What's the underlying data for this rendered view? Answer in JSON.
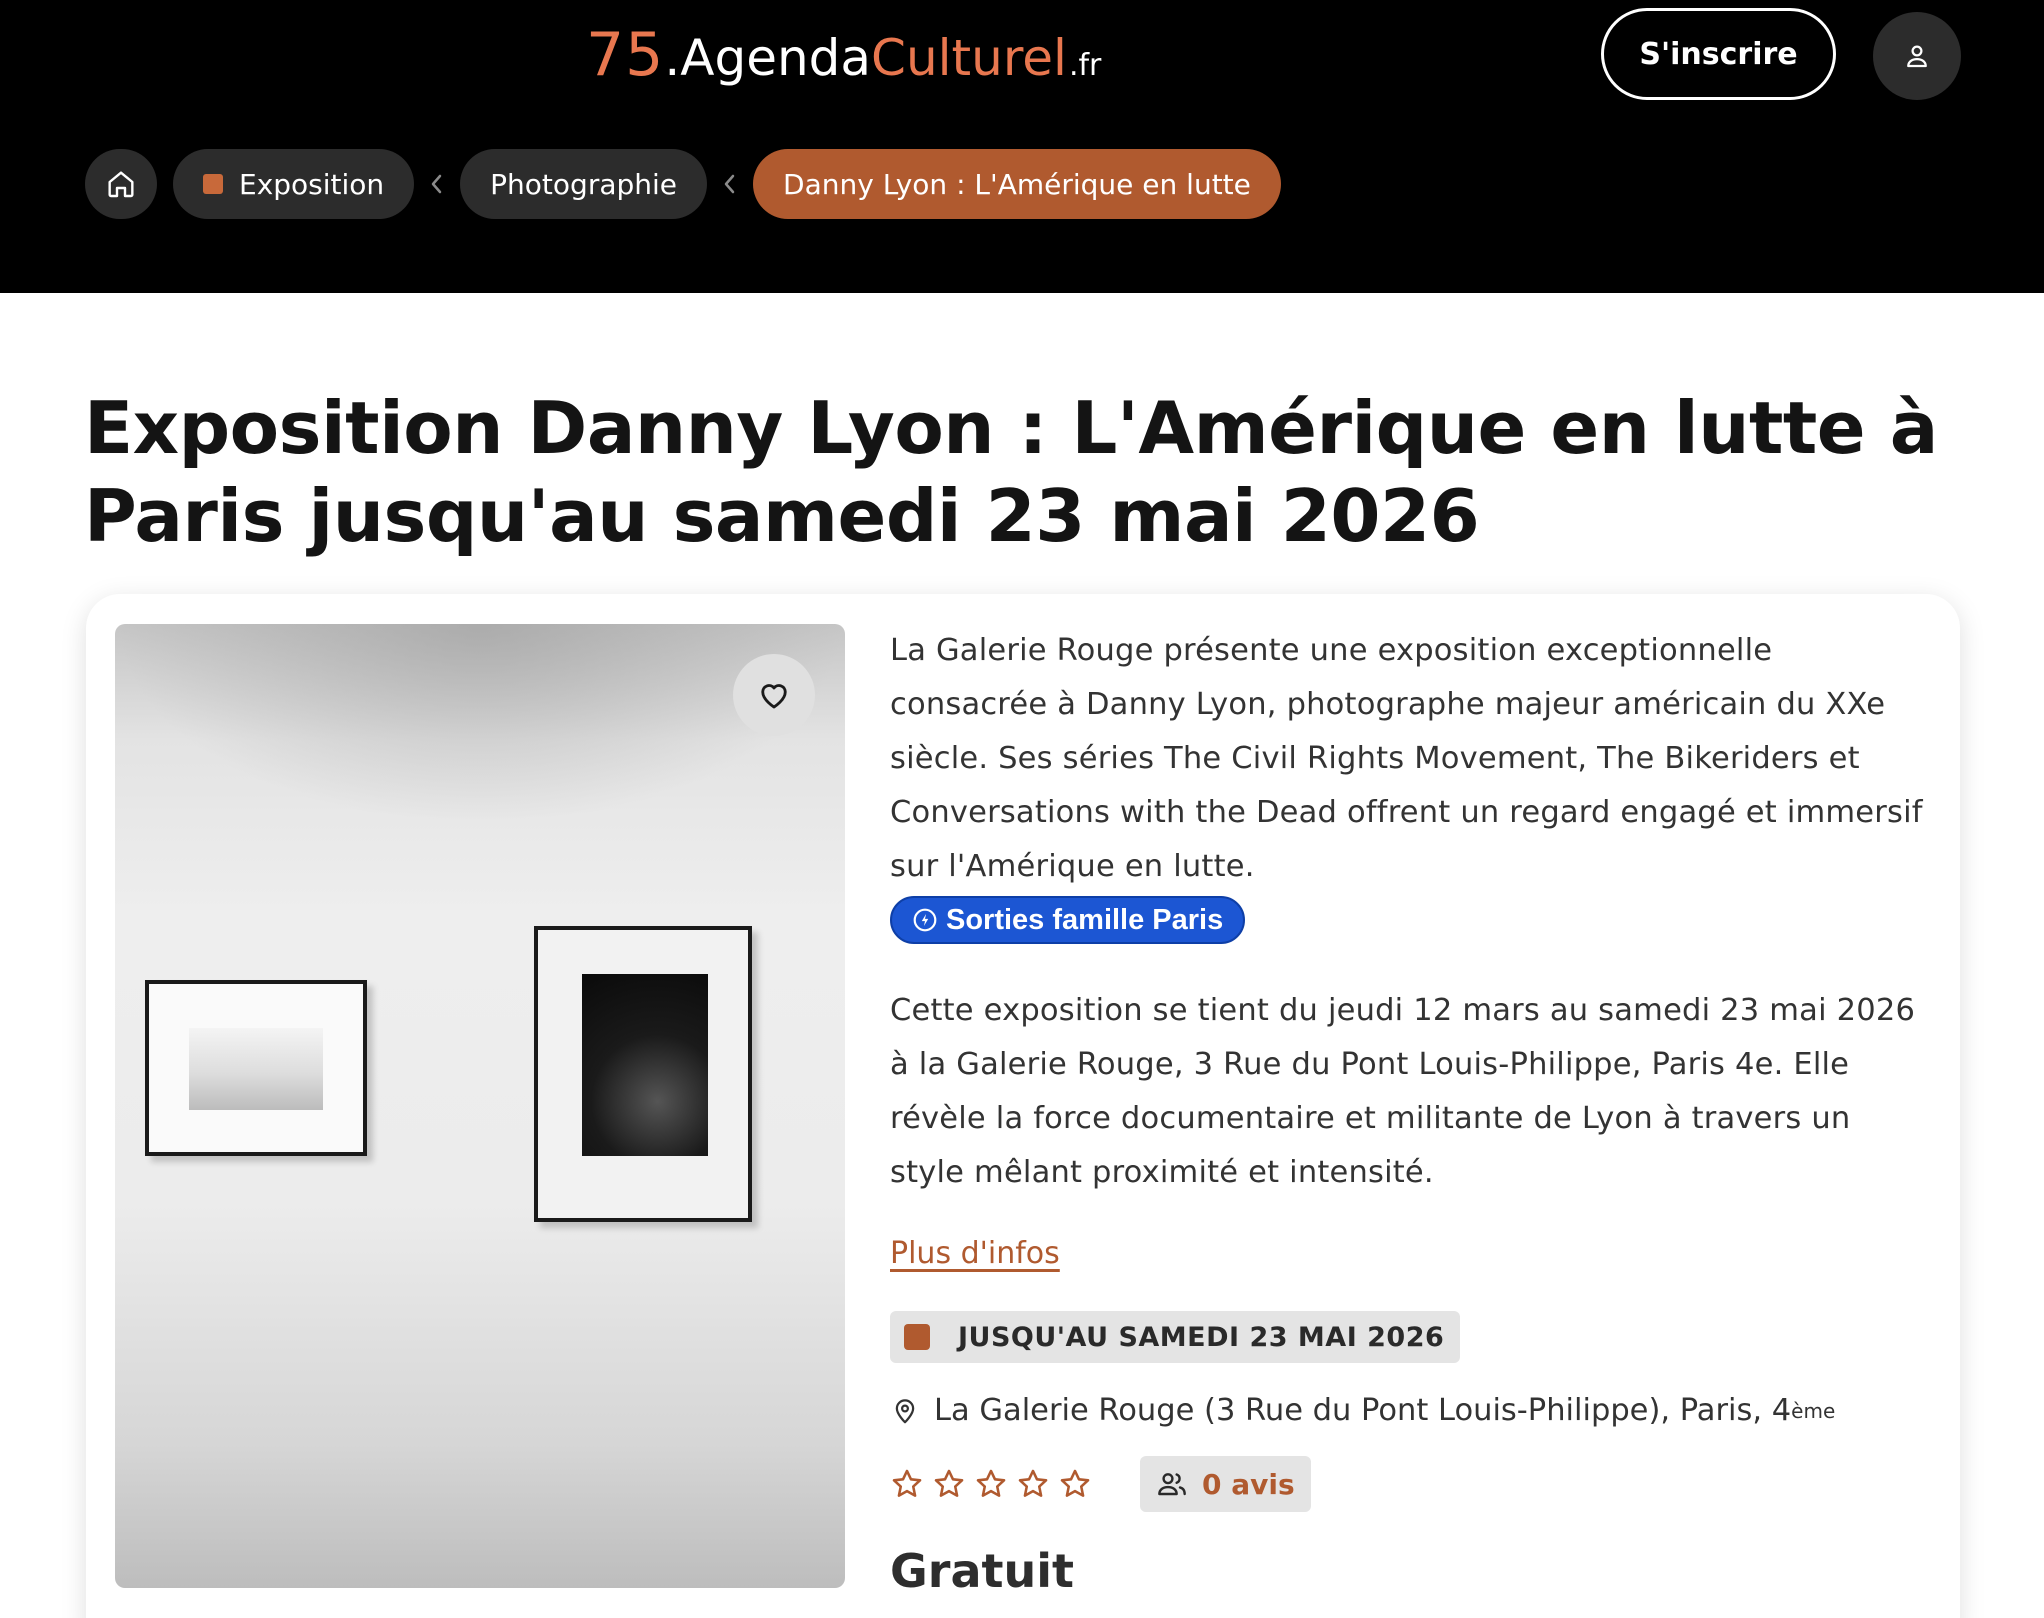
{
  "header": {
    "logo": {
      "number": "75",
      "dot": ".",
      "word1": "Agenda",
      "word2": "Culturel",
      "tld": ".fr"
    },
    "signup_label": "S'inscrire",
    "user_icon": "user-icon"
  },
  "breadcrumb": {
    "home_icon": "home-icon",
    "items": [
      {
        "label": "Exposition"
      },
      {
        "label": "Photographie"
      },
      {
        "label": "Danny Lyon : L'Amérique en lutte"
      }
    ]
  },
  "page": {
    "title": "Exposition Danny Lyon : L'Amérique en lutte à Paris jusqu'au samedi 23 mai 2026"
  },
  "event": {
    "description": "La Galerie Rouge présente une exposition exceptionnelle consacrée à Danny Lyon, photographe majeur américain du XXe siècle. Ses séries The Civil Rights Movement, The Bikeriders et Conversations with the Dead offrent un regard engagé et immersif sur l'Amérique en lutte.",
    "tag": "Sorties famille Paris",
    "details": "Cette exposition se tient du jeudi 12 mars au samedi 23 mai 2026 à la Galerie Rouge, 3 Rue du Pont Louis-Philippe, Paris 4e. Elle révèle la force documentaire et militante de Lyon à travers un style mêlant proximité et intensité.",
    "more_link": "Plus d'infos",
    "date_badge": "JUSQU'AU SAMEDI 23 MAI 2026",
    "location": "La Galerie Rouge (3 Rue du Pont Louis-Philippe), Paris, 4",
    "location_sup": "ème",
    "rating": 0,
    "rating_max": 5,
    "reviews": "0 avis",
    "price": "Gratuit"
  },
  "colors": {
    "accent": "#b05a2f",
    "logo_orange": "#e8774f",
    "tag_blue": "#1c56d3"
  }
}
